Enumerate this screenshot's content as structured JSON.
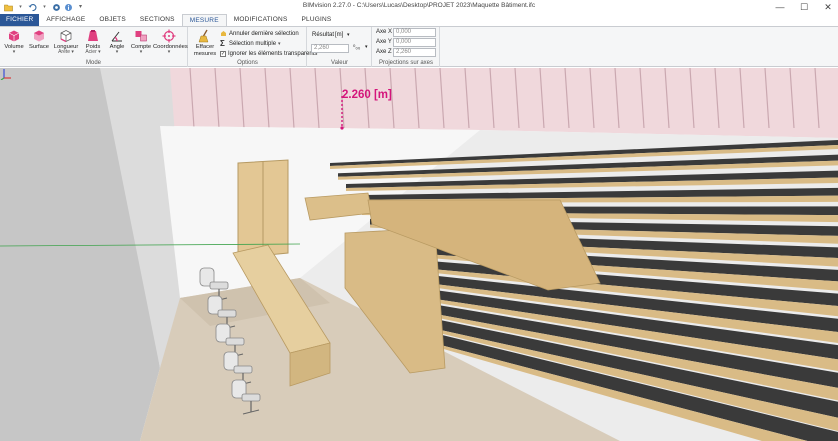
{
  "app": {
    "title": "BIMvision 2.27.0 - C:\\Users\\Lucas\\Desktop\\PROJET 2023\\Maquette Bâtiment.ifc"
  },
  "quick_access": [
    "folder-open-icon",
    "save-icon",
    "undo-icon",
    "redo-icon",
    "record-icon",
    "info-icon",
    "customize-icon"
  ],
  "window_controls": {
    "minimize": "—",
    "maximize": "☐",
    "close": "✕"
  },
  "tabs": [
    {
      "label": "FICHIER",
      "kind": "file"
    },
    {
      "label": "AFFICHAGE"
    },
    {
      "label": "OBJETS"
    },
    {
      "label": "SECTIONS"
    },
    {
      "label": "MESURE",
      "active": true
    },
    {
      "label": "MODIFICATIONS"
    },
    {
      "label": "PLUGINS"
    }
  ],
  "ribbon": {
    "mode_group": {
      "label": "Mode",
      "buttons": [
        {
          "label": "Volume",
          "sub": "▾"
        },
        {
          "label": "Surface",
          "sub": ""
        },
        {
          "label": "Longueur",
          "sub": "Arête ▾"
        },
        {
          "label": "Poids",
          "sub": "Acier ▾"
        },
        {
          "label": "Angle",
          "sub": "▾"
        },
        {
          "label": "Compte",
          "sub": "▾"
        },
        {
          "label": "Coordonnées",
          "sub": "▾"
        }
      ]
    },
    "options_group": {
      "label": "Options",
      "clear_button": {
        "label": "Effacer",
        "sub": "mesures"
      },
      "undo_last": "Annuler dernière sélection",
      "multi_select": "Sélection multiple",
      "multi_select_caret": "▾",
      "ignore_transparent": "Ignorer les éléments transparents",
      "ignore_transparent_checked": true
    },
    "value_group": {
      "label": "Valeur",
      "result_label": "Résultat",
      "unit": "[m]",
      "unit_caret": "▾",
      "value": "2,260",
      "precision_label": "⁰₀₀",
      "precision_caret": "▾"
    },
    "projection_group": {
      "label": "Projections sur axes",
      "axes": [
        {
          "label": "Axe X",
          "value": "0,000"
        },
        {
          "label": "Axe Y",
          "value": "0,000"
        },
        {
          "label": "Axe Z",
          "value": "2,260"
        }
      ]
    }
  },
  "viewport": {
    "measurement_label": "2.260 [m]",
    "colors": {
      "wall_pink": "#f2d4d8",
      "wall_white": "#f7f7f7",
      "wall_grey": "#c9c9c9",
      "floor": "#d6c9b6",
      "wood": "#d9bb86",
      "seat_dark": "#3a3a3a",
      "measure": "#d4157b"
    }
  }
}
